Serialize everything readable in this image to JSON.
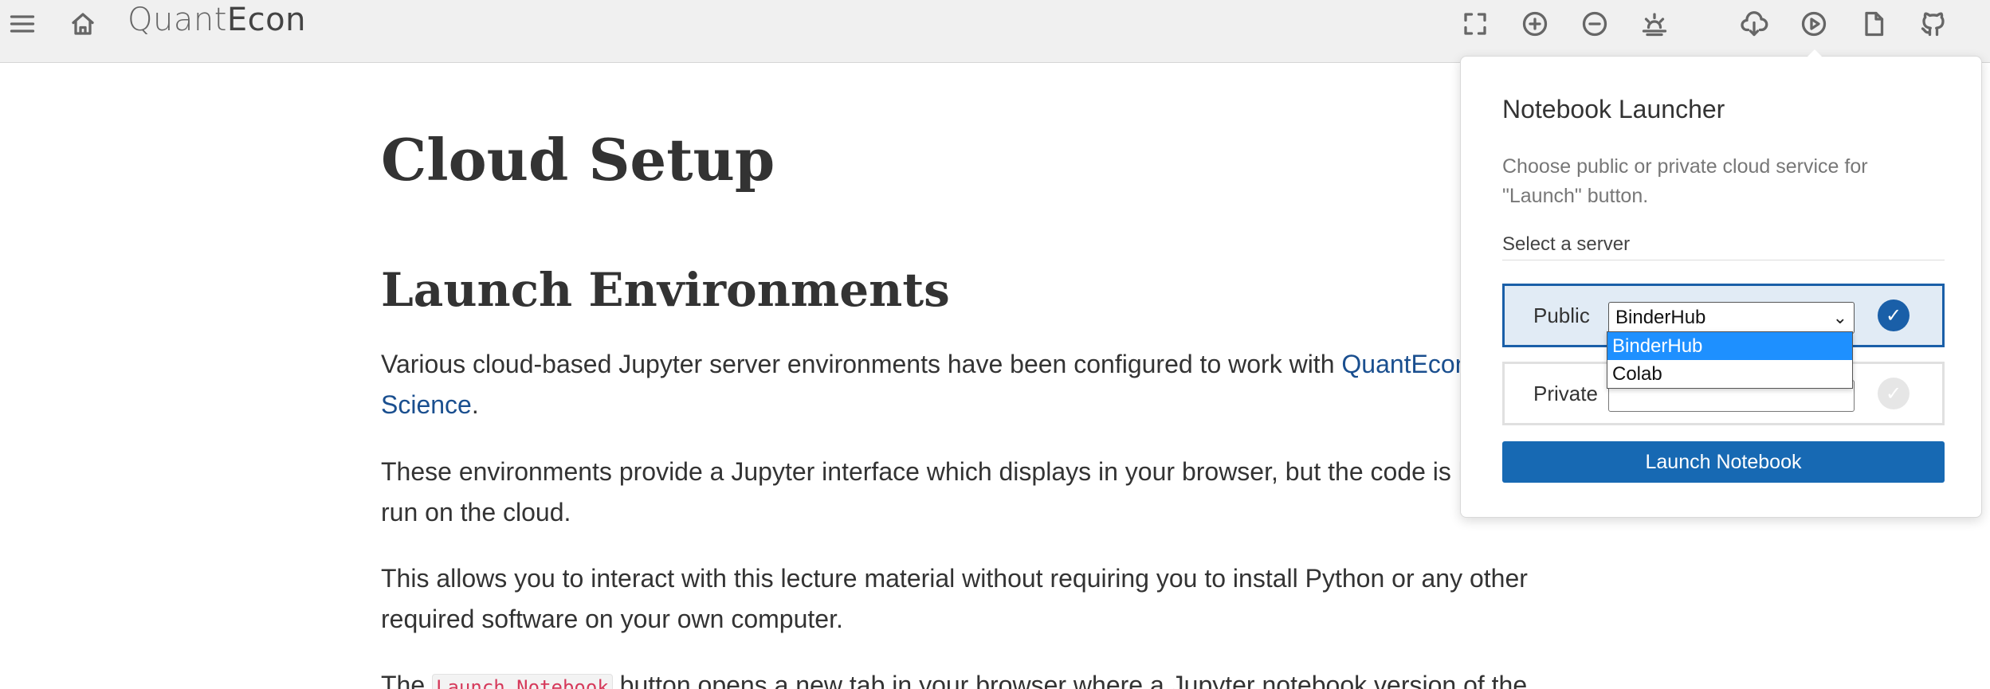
{
  "brand": {
    "part1": "Quant",
    "part2": "Econ"
  },
  "toolbar": {
    "icons": [
      "menu-icon",
      "home-icon",
      "fullscreen-icon",
      "zoom-in-icon",
      "zoom-out-icon",
      "contrast-icon",
      "download-icon",
      "launch-play-icon",
      "pdf-file-icon",
      "github-icon"
    ]
  },
  "page": {
    "title": "Cloud Setup",
    "section_title": "Launch Environments",
    "p1_text": "Various cloud-based Jupyter server environments have been configured to work with ",
    "p1_link": "QuantEcon",
    "p1_link_cont": "Science",
    "p1_end": ".",
    "p2_text": "These environments provide a Jupyter interface which displays in your browser, but the code is h",
    "p2_text_cont": "run on the cloud.",
    "p3_text": "This allows you to interact with this lecture material without requiring you to install Python or any other required software on your own computer.",
    "p4_start": "The ",
    "p4_code": "Launch Notebook",
    "p4_end": " button opens a new tab in your browser where a Jupyter notebook version of the"
  },
  "launcher": {
    "title": "Notebook Launcher",
    "description": "Choose public or private cloud service for \"Launch\" button.",
    "select_label": "Select a server",
    "public_label": "Public",
    "public_selected": "BinderHub",
    "private_label": "Private",
    "private_value": "",
    "options": [
      "BinderHub",
      "Colab"
    ],
    "launch_button": "Launch Notebook",
    "check_glyph": "✓",
    "chevron_glyph": "⌄"
  }
}
